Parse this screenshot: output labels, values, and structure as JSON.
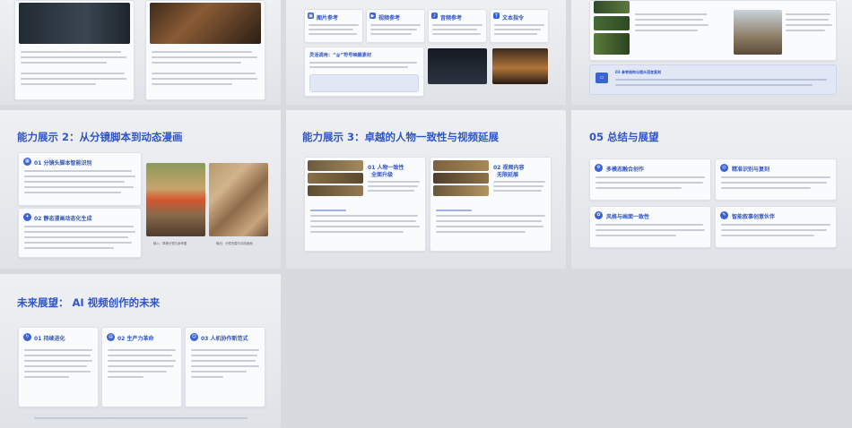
{
  "slides": {
    "capability2": {
      "title": "能力展示 2：从分镜脚本到动态漫画",
      "card1_title": "01 分镜头脚本智能识别",
      "card2_title": "02 静态漫画动态化生成",
      "photo1_caption": "输入：草稿分镜与参考图",
      "photo2_caption": "输出：分镜完整与动态画面"
    },
    "capability3": {
      "title": "能力展示 3：卓越的人物一致性与视频延展",
      "card1_title_a": "01 人物一致性",
      "card1_title_b": "全面升级",
      "card2_title_a": "02 视频内容",
      "card2_title_b": "无限延展"
    },
    "summary": {
      "title": "05 总结与展望",
      "cards": [
        {
          "label": "多模态融合创作"
        },
        {
          "label": "精准识别与复刻"
        },
        {
          "label": "风格与画面一致性"
        },
        {
          "label": "智能叙事创意伙伴"
        }
      ]
    },
    "top_right": {
      "band_title": "03 参考结构与镜头语言复刻"
    },
    "top_middle": {
      "cards": [
        {
          "label": "图片参考"
        },
        {
          "label": "视频参考"
        },
        {
          "label": "音频参考"
        },
        {
          "label": "文本指令"
        }
      ],
      "band_title": "灵活调用：“@”符号唤醒素材"
    },
    "future": {
      "title": "未来展望： AI 视频创作的未来",
      "cards": [
        {
          "label": "01 持续进化"
        },
        {
          "label": "02 生产力革命"
        },
        {
          "label": "03 人机协作新范式"
        }
      ]
    }
  },
  "colors": {
    "accent": "#2f56c9",
    "icon": "#3a63d6",
    "background": "#d7dade"
  }
}
